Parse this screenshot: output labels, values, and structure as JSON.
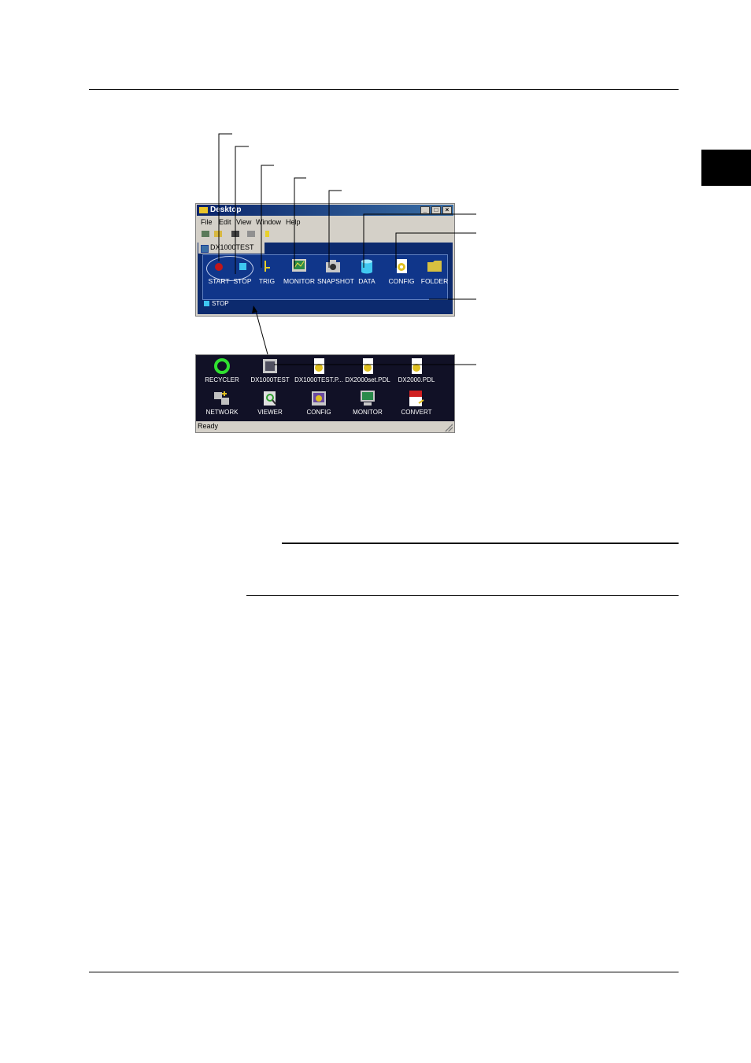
{
  "window": {
    "title": "Desktop",
    "controls": {
      "minimize": "_",
      "maximize": "□",
      "close": "×"
    },
    "menu": [
      "File",
      "Edit",
      "View",
      "Window",
      "Help"
    ],
    "document_tab": "DX1000TEST",
    "panel_items": [
      "START",
      "STOP",
      "TRIG",
      "MONITOR",
      "SNAPSHOT",
      "DATA",
      "CONFIG",
      "FOLDER"
    ],
    "status": "STOP"
  },
  "desktop": {
    "row1": [
      "RECYCLER",
      "DX1000TEST",
      "DX1000TEST.P...",
      "DX2000set.PDL",
      "DX2000.PDL"
    ],
    "row2": [
      "NETWORK",
      "VIEWER",
      "CONFIG",
      "MONITOR",
      "CONVERT"
    ],
    "status": "Ready"
  },
  "colors": {
    "mdi_background": "#0c2a6e",
    "panel_background": "#10368a",
    "desktop_background": "#111126",
    "start_red": "#c0161a",
    "stop_cyan": "#3ec6f0",
    "trig_yellow": "#e8d02a"
  }
}
